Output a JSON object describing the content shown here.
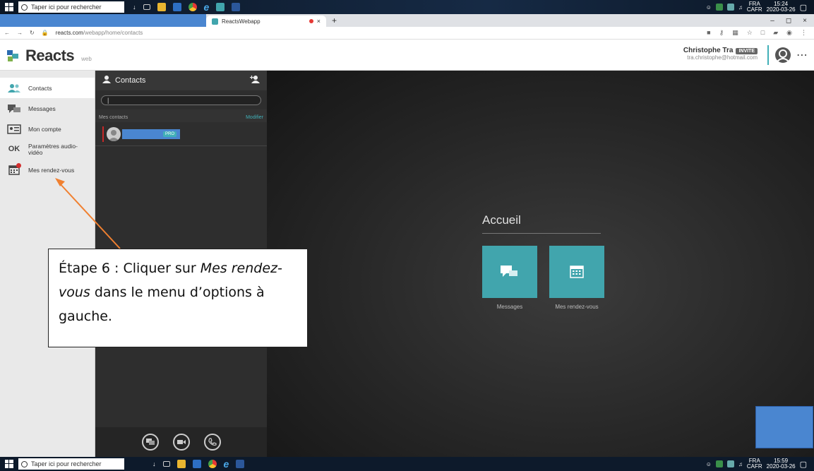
{
  "taskbar_top": {
    "search_placeholder": "Taper ici pour rechercher",
    "lang": "FRA",
    "region": "CAFR",
    "time": "15:24",
    "date": "2020-03-26"
  },
  "browser": {
    "tab_title": "ReactsWebapp",
    "url_host": "reacts.com",
    "url_path": "/webapp/home/contacts"
  },
  "app": {
    "logo": "Reacts",
    "logo_suffix": "web",
    "user_name": "Christophe Tra",
    "user_badge": "INVITE",
    "user_email": "tra.christophe@hotmail.com"
  },
  "sidebar": {
    "items": [
      {
        "label": "Contacts",
        "icon": "contacts-icon"
      },
      {
        "label": "Messages",
        "icon": "messages-icon"
      },
      {
        "label": "Mon compte",
        "icon": "account-card-icon"
      },
      {
        "label": "Paramètres audio-vidéo",
        "icon": "audio-video-settings-icon"
      },
      {
        "label": "Mes rendez-vous",
        "icon": "calendar-icon"
      }
    ]
  },
  "contacts_panel": {
    "title": "Contacts",
    "section_label": "Mes contacts",
    "edit_label": "Modifier",
    "contact_badge": "PRO"
  },
  "main": {
    "title": "Accueil",
    "tiles": [
      {
        "label": "Messages",
        "icon": "messages-icon"
      },
      {
        "label": "Mes rendez-vous",
        "icon": "calendar-icon"
      }
    ]
  },
  "callout": {
    "prefix": "Étape 6 : Cliquer sur ",
    "emphasis": "Mes rendez-vous",
    "suffix": " dans le menu d’options à gauche."
  },
  "taskbar_bottom": {
    "search_placeholder": "Taper ici pour rechercher",
    "lang": "FRA",
    "region": "CAFR",
    "time": "15:59",
    "date": "2020-03-26"
  },
  "colors": {
    "accent": "#41a5ad",
    "redaction": "#4a86d0",
    "arrow": "#f08030"
  }
}
